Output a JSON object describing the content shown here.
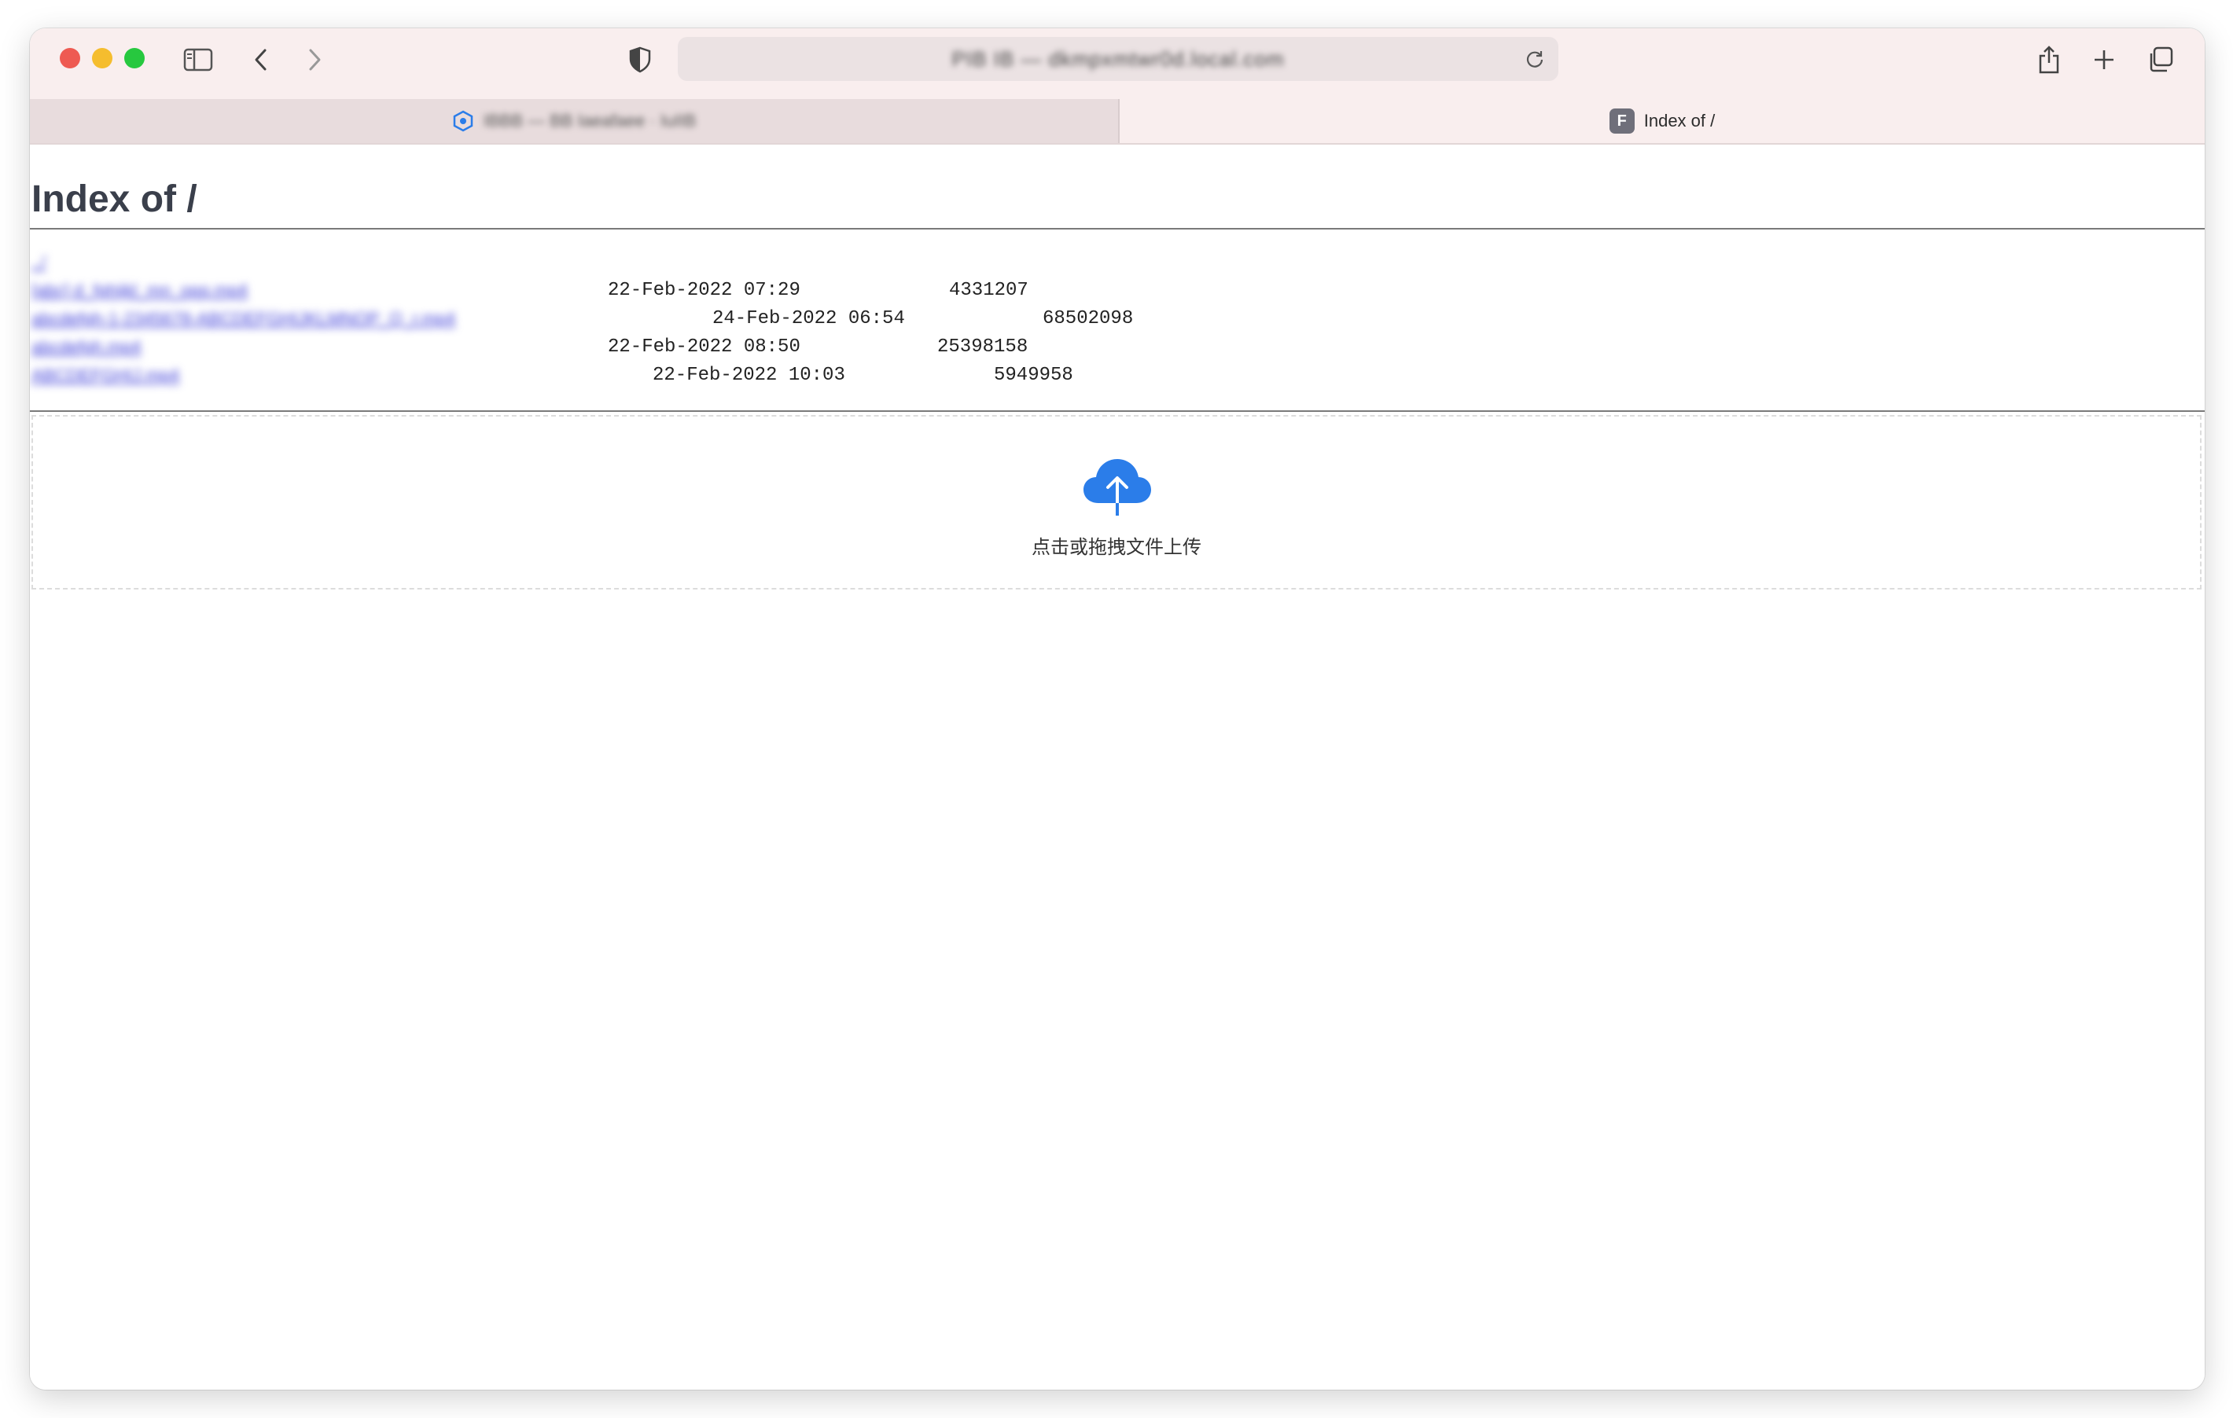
{
  "browser": {
    "address_text": "PIB IB — dkmpxmtwr0d.local.com",
    "tabs": [
      {
        "title": "IBBB — BB Iaeafaee · IuIIB",
        "active": false
      },
      {
        "title": "Index of /",
        "active": true,
        "favicon_letter": "F"
      }
    ]
  },
  "page": {
    "title": "Index of /",
    "parent_link": "../",
    "files": [
      {
        "name": "[abc] d_fghijkl_mn_opq.mp4",
        "date": "22-Feb-2022 07:29",
        "size": "4331207"
      },
      {
        "name": "abcdefgh-1-2345678-ABCDEFGHIJKLMNOP_Q_r.mp4",
        "date": "24-Feb-2022 06:54",
        "size": "68502098"
      },
      {
        "name": "abcdefgh.mp4",
        "date": "22-Feb-2022 08:50",
        "size": "25398158"
      },
      {
        "name": "ABCDEFGHIJ.mp4",
        "date": "22-Feb-2022 10:03",
        "size": "5949958"
      }
    ],
    "upload": {
      "label": "点击或拖拽文件上传",
      "icon": "cloud-upload-icon",
      "accent_color": "#2b7de9"
    }
  }
}
